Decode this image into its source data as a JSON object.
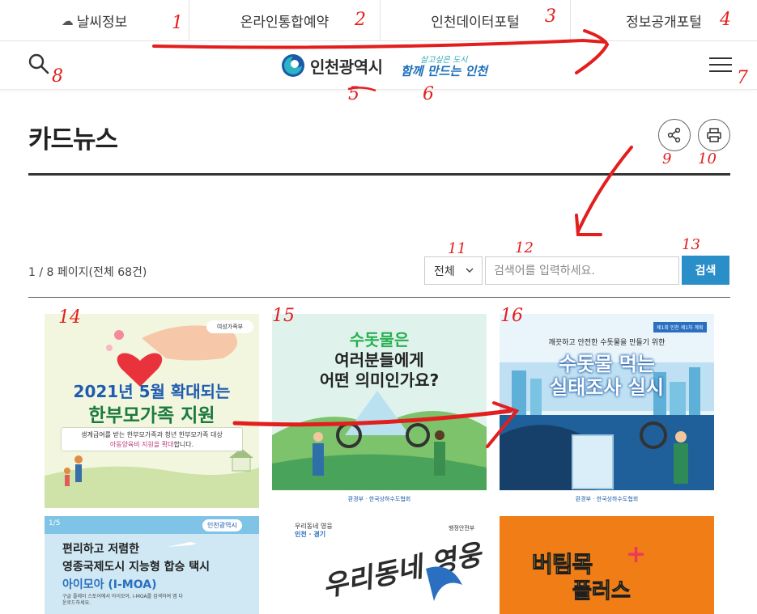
{
  "topbar": {
    "items": [
      {
        "label": "날씨정보",
        "icon": "weather-icon"
      },
      {
        "label": "온라인통합예약"
      },
      {
        "label": "인천데이터포털"
      },
      {
        "label": "정보공개포털"
      }
    ]
  },
  "header": {
    "logo_text": "인천광역시",
    "slogan_line1": "살고싶은 도시",
    "slogan_line2": "함께 만드는 인천"
  },
  "page": {
    "title": "카드뉴스",
    "page_info": "1 / 8 페이지(전체 68건)"
  },
  "search": {
    "filter_selected": "전체",
    "placeholder": "검색어를 입력하세요.",
    "button_label": "검색"
  },
  "cards": [
    {
      "ministry": "여성가족부",
      "title1": "2021년 5월 확대되는",
      "title2": "한부모가족 지원",
      "desc1": "생계급여를 받는 한부모가족과 청년 한부모가족 대상",
      "desc2_highlight": "아동양육비 지원을 확대",
      "desc2_rest": "합니다."
    },
    {
      "t1": "수돗물은",
      "t2": "여러분들에게",
      "t3": "어떤 의미인가요?",
      "footer": "환경부 · 한국상하수도협회"
    },
    {
      "badge": "제1회 인천 제1차 계획",
      "t1": "깨끗하고 안전한 수돗물을 만들기 위한",
      "t2": "수돗물 먹는",
      "t3": "실태조사 실시",
      "footer": "환경부 · 한국상하수도협회"
    },
    {
      "page": "1/5",
      "brand": "인천광역시",
      "l1": "편리하고 저렴한",
      "l2": "영종국제도시 지능형 합승 택시",
      "l3": "아이모아 (I-MOA)",
      "l4": "구글 플레이 스토어에서 아이모아, I-MOA를 검색하여 앱 다운로드하세요."
    },
    {
      "org_line1": "우리동네 영웅",
      "org_line2": "인천 · 경기",
      "org2": "행정안전부",
      "big": "우리동네 영웅"
    },
    {
      "big1": "버팀목",
      "big2": "플러스",
      "plus": "+"
    }
  ],
  "annotations": [
    "1",
    "2",
    "3",
    "4",
    "5",
    "6",
    "7",
    "8",
    "9",
    "10",
    "11",
    "12",
    "13",
    "14",
    "15",
    "16"
  ],
  "colors": {
    "accent": "#2a8fc9",
    "annotation": "#e31e1e",
    "title_rule": "#333333"
  }
}
